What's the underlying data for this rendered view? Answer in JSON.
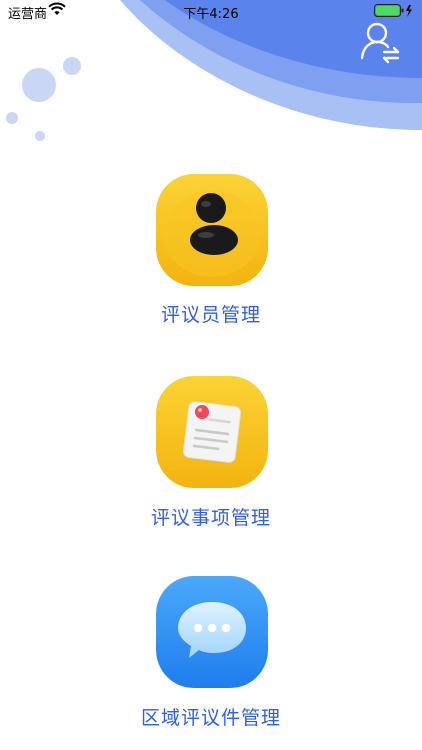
{
  "status_bar": {
    "carrier": "运营商",
    "time": "下午4:26",
    "icons": [
      "wifi-icon",
      "battery-icon",
      "charging-bolt-icon"
    ]
  },
  "header": {
    "switch_user_icon": "switch-user-icon"
  },
  "menu": {
    "items": [
      {
        "label": "评议员管理",
        "icon": "person-icon"
      },
      {
        "label": "评议事项管理",
        "icon": "document-note-icon"
      },
      {
        "label": "区域评议件管理",
        "icon": "chat-bubble-icon"
      }
    ]
  },
  "colors": {
    "accent_blue": "#2f62d6",
    "wave_light": "#a9c0f4",
    "wave_mid": "#7f9ff0",
    "wave_dark": "#5a83eb",
    "tile_yellow": "#f6c21c",
    "tile_blue": "#2f8cf3"
  }
}
